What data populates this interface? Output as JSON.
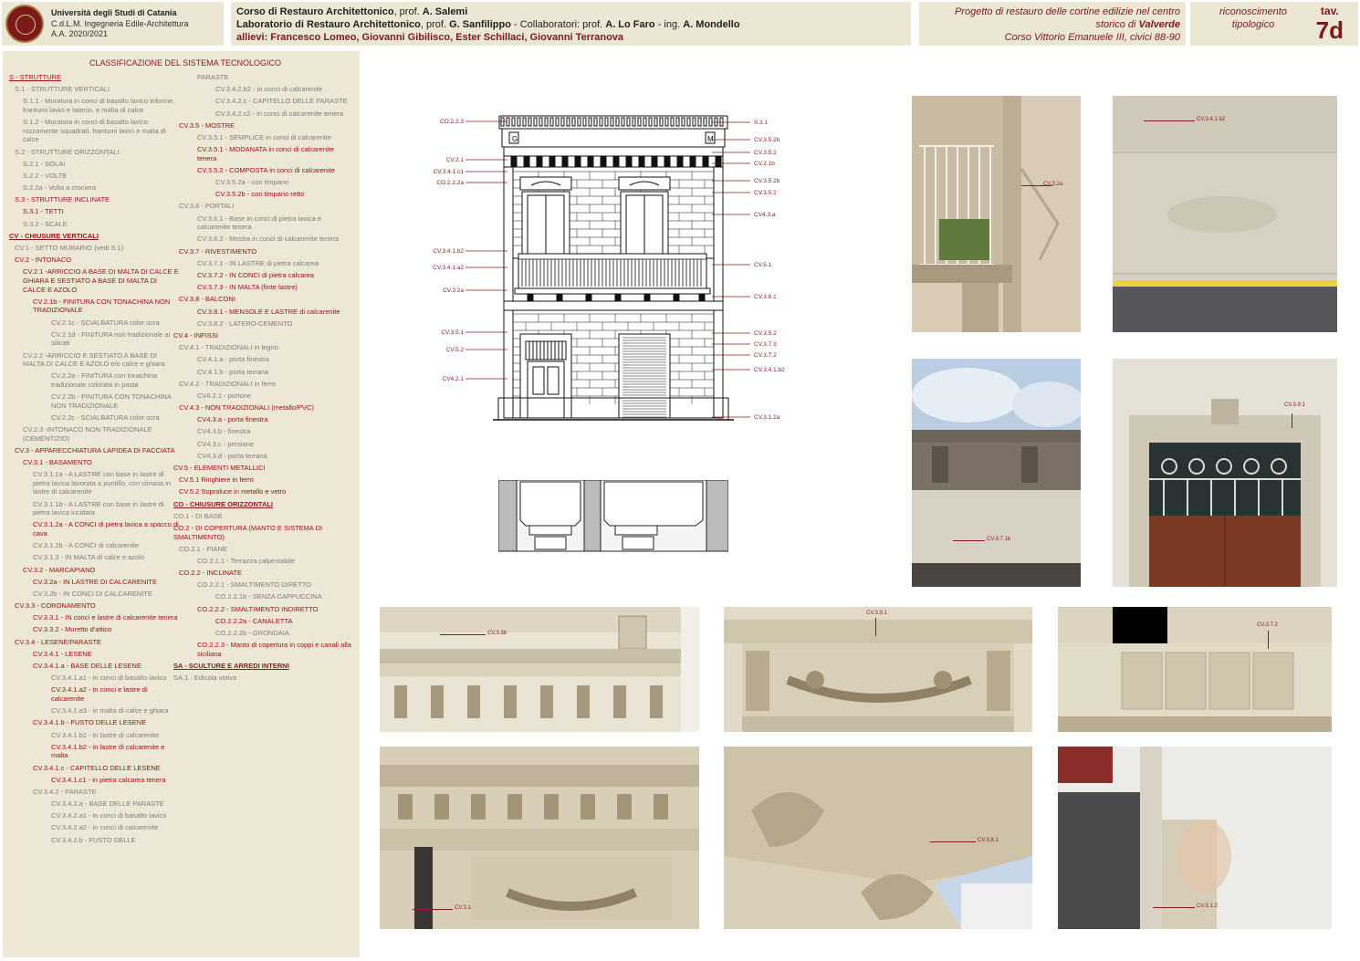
{
  "header": {
    "university": "Università degli Studi di Catania",
    "program": "C.d.L.M. Ingegneria Edile-Architettura",
    "year": "A.A. 2020/2021",
    "course_line1_a": "Corso di Restauro Architettonico",
    "course_line1_b": ", prof. ",
    "course_line1_c": "A. Salemi",
    "course_line2_a": "Laboratorio di Restauro Architettonico",
    "course_line2_b": ", prof. ",
    "course_line2_c": "G. Sanfilippo",
    "course_line2_d": " - Collaboratori: prof. ",
    "course_line2_e": "A. Lo Faro",
    "course_line2_f": " - ing. ",
    "course_line2_g": "A. Mondello",
    "students_label": "allievi:  ",
    "students": "Francesco Lomeo, Giovanni Gibilisco, Ester Schillaci, Giovanni Terranova",
    "project_line1": "Progetto di restauro delle cortine edilizie nel centro",
    "project_line2_a": "storico di ",
    "project_line2_b": "Valverde",
    "project_line3": "Corso Vittorio Emanuele III, civici 88-90",
    "recognition": "riconoscimento tipologico",
    "tav_label": "tav.",
    "tav_number": "7d"
  },
  "classification": {
    "title": "CLASSIFICAZIONE DEL SISTEMA TECNOLOGICO",
    "col1": [
      {
        "t": "S - STRUTTURE",
        "c": "red l0 u"
      },
      {
        "t": "S.1 - STRUTTURE VERTICALI",
        "c": "grey l1"
      },
      {
        "t": "S.1.1 - Muratura in conci di basalto lavico informe, frantumi lavici e laterizi, e malta di calce",
        "c": "grey l2"
      },
      {
        "t": "S.1.2 - Muratura in conci di basalto lavico rozzamente squadrati, frantumi lavici e malta di calce",
        "c": "grey l2"
      },
      {
        "t": "S.2 - STRUTTURE ORIZZONTALI",
        "c": "grey l1"
      },
      {
        "t": "S.2.1 - SOLAI",
        "c": "grey l2"
      },
      {
        "t": "S.2.2 - VOLTE",
        "c": "grey l2"
      },
      {
        "t": "S.2.2a - Volta a crociera",
        "c": "grey l2"
      },
      {
        "t": "S.3 - STRUTTURE INCLINATE",
        "c": "red l1"
      },
      {
        "t": "S.3.1 - TETTI",
        "c": "red l2"
      },
      {
        "t": "S.3.2 - SCALE",
        "c": "grey l2"
      },
      {
        "t": "CV - CHIUSURE VERTICALI",
        "c": "bd l0"
      },
      {
        "t": "CV.1 - SETTO MURARIO (vedi S.1)",
        "c": "grey l1"
      },
      {
        "t": "CV.2 - INTONACO",
        "c": "red l1"
      },
      {
        "t": "CV.2.1 -ARRICCIO A BASE DI MALTA DI CALCE E GHIARA E SESTIATO A BASE DI MALTA DI CALCE E AZOLO",
        "c": "red l2"
      },
      {
        "t": "CV.2.1b - FINITURA CON TONACHINA NON TRADIZIONALE",
        "c": "red l3"
      },
      {
        "t": "CV.2.1c - SCIALBATURA color ocra",
        "c": "grey l4"
      },
      {
        "t": "CV.2.1d - FINITURA non tradizionale ai silicati",
        "c": "grey l4"
      },
      {
        "t": "CV.2.2 -ARRICCIO E SESTIATO A BASE DI MALTA DI CALCE E AZOLO e/o calce e ghiara",
        "c": "grey l2"
      },
      {
        "t": "CV.2.2a - FINITURA con tonachina tradizionale colorata in pasta",
        "c": "grey l4"
      },
      {
        "t": "CV.2.2b - FINITURA CON TONACHINA NON TRADIZIONALE",
        "c": "grey l4"
      },
      {
        "t": "CV.2.2c - SCIALBATURA color ocra",
        "c": "grey l4"
      },
      {
        "t": "CV.2.3 -INTONACO NON TRADIZIONALE (CEMENTIZIO)",
        "c": "grey l2"
      },
      {
        "t": "CV.3 - APPARECCHIATURA LAPIDEA DI FACCIATA",
        "c": "red l1"
      },
      {
        "t": "CV.3.1 - BASAMENTO",
        "c": "red l2"
      },
      {
        "t": "CV.3.1.1a - A LASTRE con base in lastre di pietra lavica lavorata a puntillo, con cimasa in lastre di calcarenite",
        "c": "grey l3"
      },
      {
        "t": "CV.3.1.1b - A LASTRE con base in lastre di pietra lavica lucidata",
        "c": "grey l3"
      },
      {
        "t": "CV.3.1.2a - A CONCI di pietra lavica a spacco di cava",
        "c": "red l3"
      },
      {
        "t": "CV.3.1.2b - A CONCI di calcarenite",
        "c": "grey l3"
      },
      {
        "t": "CV.3.1.3 - IN MALTA di calce e azolo",
        "c": "grey l3"
      },
      {
        "t": "CV.3.2 - MARCAPIANO",
        "c": "red l2"
      },
      {
        "t": "CV.3.2a - IN LASTRE DI CALCARENITE",
        "c": "red l3"
      },
      {
        "t": "CV.3.2b - IN CONCI DI CALCARENITE",
        "c": "grey l3"
      },
      {
        "t": "CV.3.3 - CORONAMENTO",
        "c": "red l1"
      },
      {
        "t": "CV.3.3.1 - IN conci e lastre di calcarenite tenera",
        "c": "red l3"
      },
      {
        "t": "CV.3.3.2 - Muretto d'attico",
        "c": "red l3"
      },
      {
        "t": "CV.3.4 - LESENE/PARASTE",
        "c": "red l1"
      },
      {
        "t": "CV.3.4.1 - LESENE",
        "c": "red l3"
      },
      {
        "t": "CV.3.4.1.a - BASE DELLE LESENE",
        "c": "red l3"
      },
      {
        "t": "CV.3.4.1.a1 - in conci di basalto lavico",
        "c": "grey l4"
      },
      {
        "t": "CV.3.4.1.a2 - in conci e lastre di calcarenite",
        "c": "red l4"
      },
      {
        "t": "CV.3.4.1.a3 - in malta di calce e ghiara",
        "c": "grey l4"
      },
      {
        "t": "CV.3.4.1.b - FUSTO DELLE LESENE",
        "c": "red l3"
      },
      {
        "t": "CV.3.4.1.b1 - in lastre di calcarenite",
        "c": "grey l4"
      },
      {
        "t": "CV.3.4.1.b2 - in lastre di calcarenite e malta",
        "c": "red l4"
      },
      {
        "t": "CV.3.4.1.c - CAPITELLO DELLE LESENE",
        "c": "red l3"
      },
      {
        "t": "CV.3.4.1.c1 - in pietra calcarea tenera",
        "c": "red l4"
      },
      {
        "t": "CV.3.4.2 - PARASTE",
        "c": "grey l3"
      },
      {
        "t": "CV.3.4.2.a - BASE DELLE PARASTE",
        "c": "grey l4"
      },
      {
        "t": "CV.3.4.2.a1 - in conci di basalto lavico",
        "c": "grey l4"
      },
      {
        "t": "CV.3.4.2.a2 - in conci di calcarenite",
        "c": "grey l4"
      },
      {
        "t": "CV.3.4.2.b - FUSTO DELLE",
        "c": "grey l4"
      }
    ],
    "col2": [
      {
        "t": "PARASTE",
        "c": "grey l3"
      },
      {
        "t": "CV.3.4.2.b2 - in conci di calcarenite",
        "c": "grey l4"
      },
      {
        "t": "CV.3.4.2.c - CAPITELLO DELLE PARASTE",
        "c": "grey l4"
      },
      {
        "t": "CV.3.4.2.c2 - in conci di calcarenite tenera",
        "c": "grey l4"
      },
      {
        "t": "CV.3.5 - MOSTRE",
        "c": "red l1"
      },
      {
        "t": "CV.3.5.1 - SEMPLICE in conci di calcarenite",
        "c": "grey l3"
      },
      {
        "t": "CV.3.5.1 - MODANATA in conci di calcarenite tenera",
        "c": "red l3"
      },
      {
        "t": "CV.3.5.2 - COMPOSTA in conci di calcarenite",
        "c": "red l3"
      },
      {
        "t": "CV.3.5.2a - con timpano",
        "c": "grey l4"
      },
      {
        "t": "CV.3.5.2b - con timpano retto",
        "c": "red l4"
      },
      {
        "t": "CV.3.6 - PORTALI",
        "c": "grey l1"
      },
      {
        "t": "CV.3.6.1 - Base in conci di pietra lavica e calcarenite tenera",
        "c": "grey l3"
      },
      {
        "t": "CV.3.6.2 - Mostra in conci di calcarenite tenera",
        "c": "grey l3"
      },
      {
        "t": "CV.3.7 - RIVESTIMENTO",
        "c": "red l1"
      },
      {
        "t": "CV.3.7.1 - IN LASTRE di pietra calcarea",
        "c": "grey l3"
      },
      {
        "t": "CV.3.7.2 - IN CONCI di pietra calcarea",
        "c": "red l3"
      },
      {
        "t": "CV.3.7.3 - IN MALTA (finte lastre)",
        "c": "red l3"
      },
      {
        "t": "CV.3.8 - BALCONI",
        "c": "red l1"
      },
      {
        "t": "CV.3.8.1 - MENSOLE E LASTRE di calcarenite",
        "c": "red l3"
      },
      {
        "t": "CV.3.8.2 - LATERO-CEMENTO",
        "c": "grey l3"
      },
      {
        "t": "CV.4 - INFISSI",
        "c": "red l0"
      },
      {
        "t": "CV.4.1 - TRADIZIONALI in legno",
        "c": "grey l1"
      },
      {
        "t": "CV.4.1.a - porta finestra",
        "c": "grey l3"
      },
      {
        "t": "CV.4.1.b - porta terrana",
        "c": "grey l3"
      },
      {
        "t": "CV.4.2 - TRADIZIONALI in ferro",
        "c": "grey l1"
      },
      {
        "t": "CV4.2.1 - portone",
        "c": "grey l3"
      },
      {
        "t": "CV.4.3 - NON TRADIZIONALI (metallo/PVC)",
        "c": "red l1"
      },
      {
        "t": "CV4.3.a - porta finestra",
        "c": "red l3"
      },
      {
        "t": "CV4.3.b - finestra",
        "c": "grey l3"
      },
      {
        "t": "CV4.3.c - persiane",
        "c": "grey l3"
      },
      {
        "t": "CV4.3.d - porta terrana",
        "c": "grey l3"
      },
      {
        "t": "CV.5 - ELEMENTI METALLICI",
        "c": "red l0"
      },
      {
        "t": "CV.5.1 Ringhiere in ferro",
        "c": "red l1"
      },
      {
        "t": "CV.5.2 Sopraluce in metallo e vetro",
        "c": "red l1"
      },
      {
        "t": "CO - CHIUSURE ORIZZONTALI",
        "c": "bd l0"
      },
      {
        "t": "CO.1 - DI BASE",
        "c": "grey l0"
      },
      {
        "t": "CO.2 - DI COPERTURA (MANTO E SISTEMA DI SMALTIMENTO)",
        "c": "red l0"
      },
      {
        "t": "CO.2.1 - PIANE",
        "c": "grey l1"
      },
      {
        "t": "CO.2.1.1 - Terrazza calpestabile",
        "c": "grey l3"
      },
      {
        "t": "CO.2.2 - INCLINATE",
        "c": "red l1"
      },
      {
        "t": "CO.2.2.1 - SMALTIMENTO DIRETTO",
        "c": "grey l3"
      },
      {
        "t": "CO.2.2.1b - SENZA CAPPUCCINA",
        "c": "grey l4"
      },
      {
        "t": "CO.2.2.2 - SMALTIMENTO INDIRETTO",
        "c": "red l3"
      },
      {
        "t": "CO.2.2.2a - CANALETTA",
        "c": "red l4"
      },
      {
        "t": "CO.2.2.2b - GRONDAIA",
        "c": "grey l4"
      },
      {
        "t": "CO.2.2.3 - Manto di copertura in coppi e canali alla siciliana",
        "c": "red l3"
      },
      {
        "t": "SA - SCULTURE E ARREDI INTERNI",
        "c": "bd l0"
      },
      {
        "t": "SA.1 - Edicola votiva",
        "c": "grey l0"
      }
    ]
  },
  "elevation": {
    "left_labels": [
      "CO.2.2.3",
      "CV.2.1",
      "CV.3.4.1.c1",
      "CO.2.2.2a",
      "CV.3.4.1.b2",
      "CV.3.4.1.a2",
      "CV.3.2a",
      "CV.3.5.1",
      "CV.5.2",
      "CV4.2.1"
    ],
    "right_labels": [
      "S.3.1",
      "CV.3.5.2b",
      "CV.3.5.2",
      "CV.2.1b",
      "CV.3.5.2b",
      "CV.3.5.2",
      "CV4.3.a",
      "CV.5.1",
      "CV.3.8.1",
      "CV.3.5.2",
      "CV.3.7.3",
      "CV.3.7.2",
      "CV.3.4.1.b2",
      "CV.3.1.2a"
    ],
    "monogram_left": "G",
    "monogram_right": "M"
  },
  "photos": [
    {
      "name": "photo-balcony-railing",
      "tag": "CV.3.2a"
    },
    {
      "name": "photo-pilaster-shaft",
      "tag": "CV.3.4.1.b2"
    },
    {
      "name": "photo-cornice-sky",
      "tag": "CV.3.7.1b"
    },
    {
      "name": "photo-door-grille",
      "tag": "CV.3.9.1"
    },
    {
      "name": "photo-cornice-monogram",
      "tag": "CV.3.3b"
    },
    {
      "name": "photo-festoon-lintel",
      "tag": "CV.3.9.1"
    },
    {
      "name": "photo-stone-blocks",
      "tag": "CV.3.7.2"
    },
    {
      "name": "photo-cornice-detail",
      "tag": "CV.3.1"
    },
    {
      "name": "photo-balcony-bracket",
      "tag": "CV.3.8.1"
    },
    {
      "name": "photo-basement-lava",
      "tag": "CV.3.1.2"
    }
  ],
  "colors": {
    "accent": "#7a1a1a",
    "panel": "#ede7d5",
    "sepia": "#e8e0cc"
  }
}
